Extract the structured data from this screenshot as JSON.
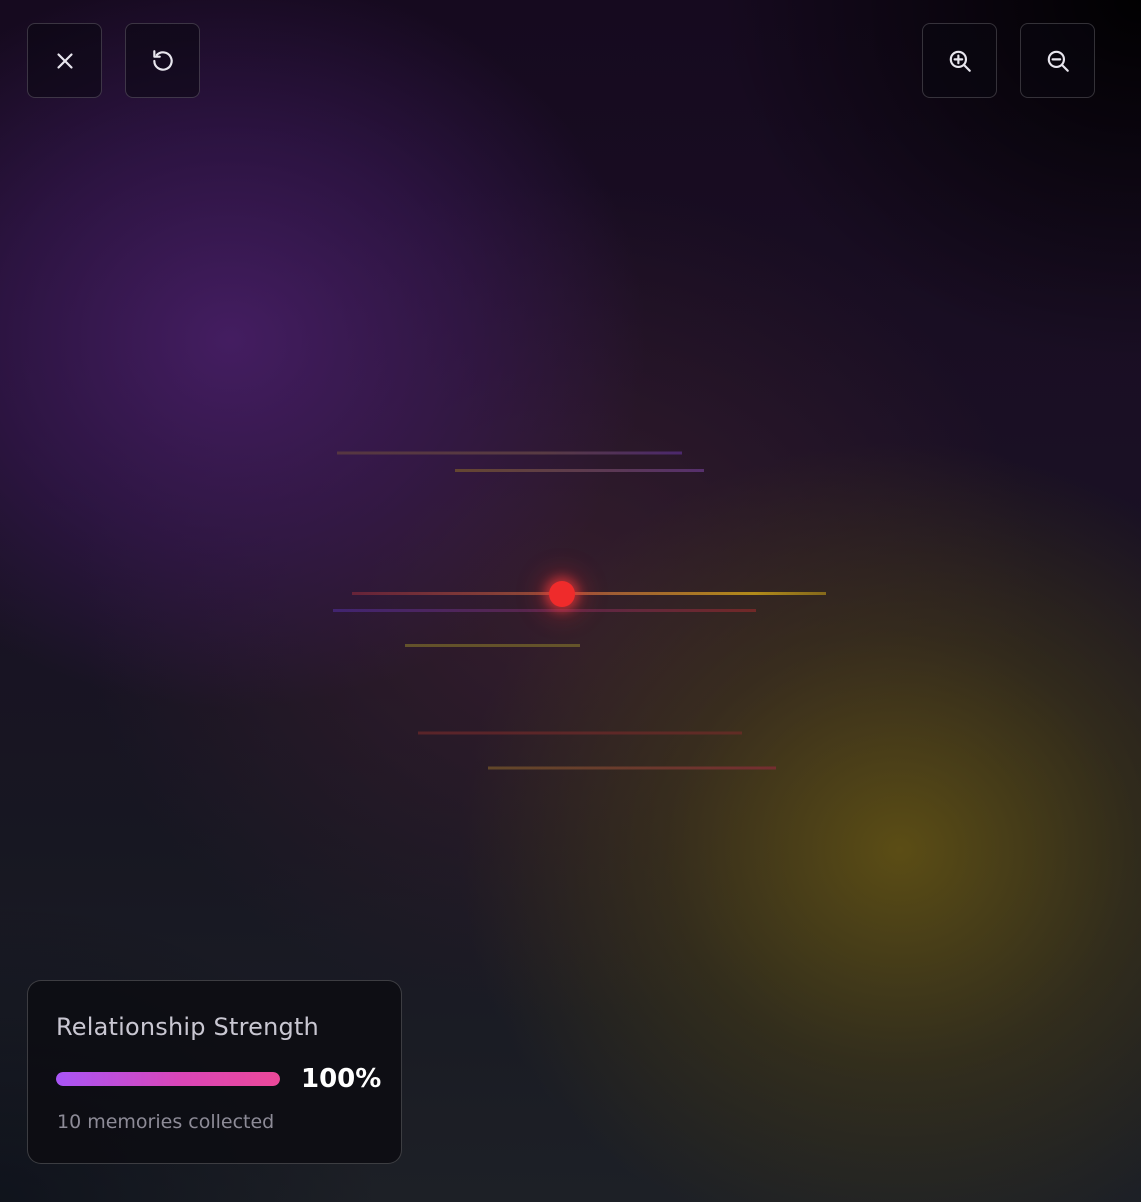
{
  "toolbar": {
    "close": {
      "icon": "close-icon"
    },
    "reset": {
      "icon": "reset-icon"
    },
    "zoom_in": {
      "icon": "zoom-in-icon"
    },
    "zoom_out": {
      "icon": "zoom-out-icon"
    }
  },
  "status_panel": {
    "title": "Relationship Strength",
    "strength_percent_label": "100%",
    "strength_fraction": 1.0,
    "memories_text": "10 memories collected"
  },
  "colors": {
    "background_top": "#160a1f",
    "purple_glow": "#461e64",
    "gold_glow": "#5f5014",
    "node": "#ef2b2b",
    "bar_start": "#a855f7",
    "bar_end": "#ec4899"
  }
}
